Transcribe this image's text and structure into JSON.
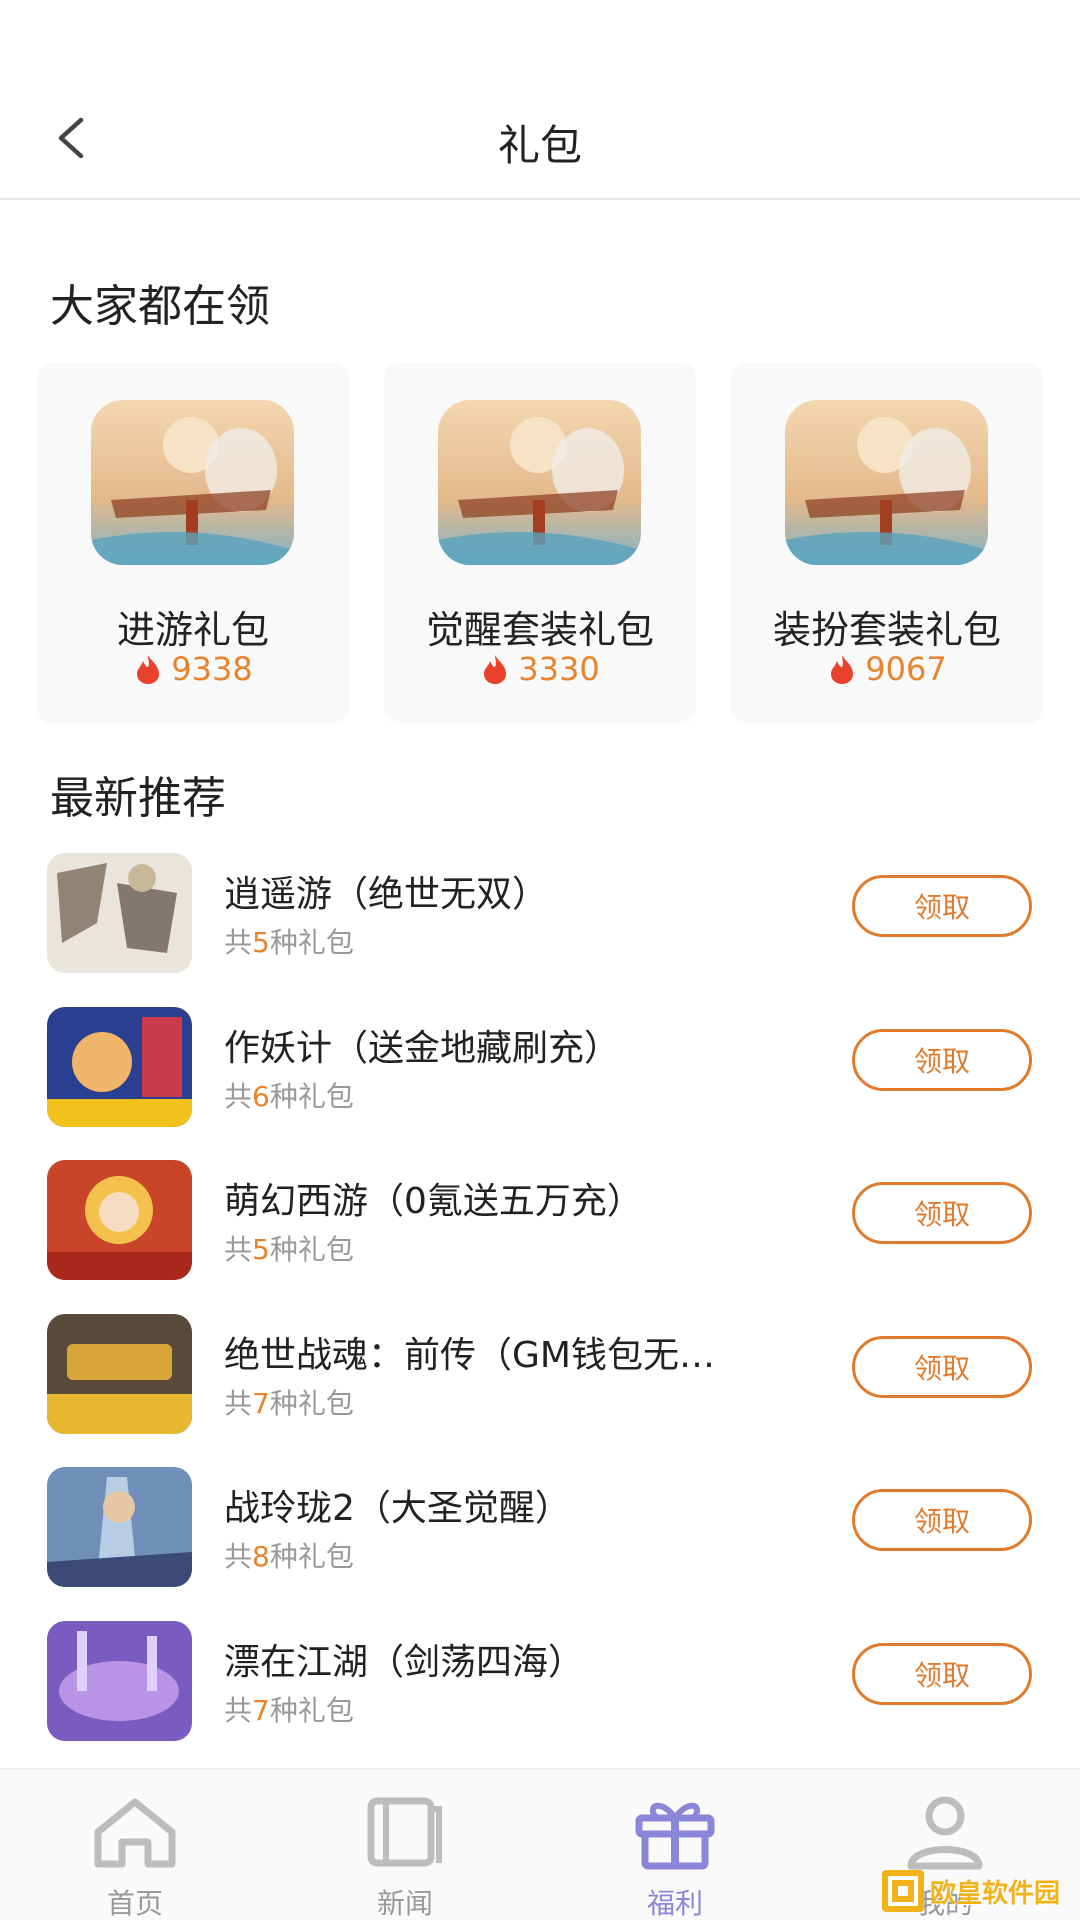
{
  "header": {
    "title": "礼包"
  },
  "popular": {
    "title": "大家都在领",
    "cards": [
      {
        "name": "进游礼包",
        "count": "9338"
      },
      {
        "name": "觉醒套装礼包",
        "count": "3330"
      },
      {
        "name": "装扮套装礼包",
        "count": "9067"
      }
    ]
  },
  "latest": {
    "title": "最新推荐",
    "items": [
      {
        "title": "逍遥游（绝世无双）",
        "sub_prefix": "共",
        "sub_count": "5",
        "sub_suffix": "种礼包",
        "button": "领取"
      },
      {
        "title": "作妖计（送金地藏刷充）",
        "sub_prefix": "共",
        "sub_count": "6",
        "sub_suffix": "种礼包",
        "button": "领取"
      },
      {
        "title": "萌幻西游（0氪送五万充）",
        "sub_prefix": "共",
        "sub_count": "5",
        "sub_suffix": "种礼包",
        "button": "领取"
      },
      {
        "title": "绝世战魂：前传（GM钱包无…",
        "sub_prefix": "共",
        "sub_count": "7",
        "sub_suffix": "种礼包",
        "button": "领取"
      },
      {
        "title": "战玲珑2（大圣觉醒）",
        "sub_prefix": "共",
        "sub_count": "8",
        "sub_suffix": "种礼包",
        "button": "领取"
      },
      {
        "title": "漂在江湖（剑荡四海）",
        "sub_prefix": "共",
        "sub_count": "7",
        "sub_suffix": "种礼包",
        "button": "领取"
      }
    ]
  },
  "tabbar": {
    "tabs": [
      {
        "label": "首页",
        "icon": "home-icon"
      },
      {
        "label": "新闻",
        "icon": "book-icon"
      },
      {
        "label": "福利",
        "icon": "gift-icon",
        "active": true
      },
      {
        "label": "我的",
        "icon": "user-icon"
      }
    ]
  },
  "watermark": {
    "text": "欧皇软件园"
  },
  "colors": {
    "accent": "#e07a2c",
    "count": "#e8842e",
    "active_tab": "#8a86d8",
    "fire": "#e8412c"
  }
}
